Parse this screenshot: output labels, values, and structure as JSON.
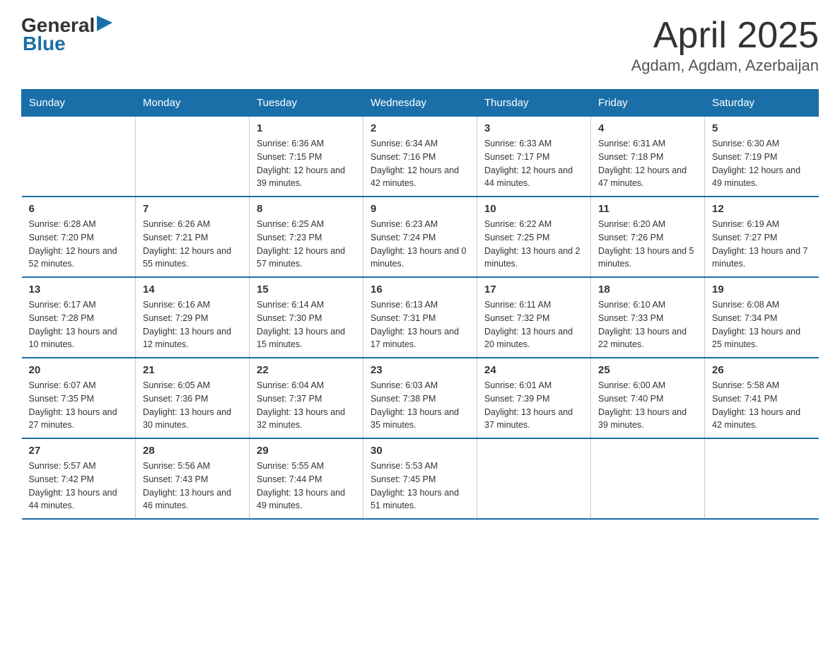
{
  "header": {
    "logo": {
      "general": "General",
      "arrow": "▶",
      "blue": "Blue"
    },
    "title": "April 2025",
    "subtitle": "Agdam, Agdam, Azerbaijan"
  },
  "calendar": {
    "weekdays": [
      "Sunday",
      "Monday",
      "Tuesday",
      "Wednesday",
      "Thursday",
      "Friday",
      "Saturday"
    ],
    "weeks": [
      [
        {
          "day": "",
          "sunrise": "",
          "sunset": "",
          "daylight": ""
        },
        {
          "day": "",
          "sunrise": "",
          "sunset": "",
          "daylight": ""
        },
        {
          "day": "1",
          "sunrise": "Sunrise: 6:36 AM",
          "sunset": "Sunset: 7:15 PM",
          "daylight": "Daylight: 12 hours and 39 minutes."
        },
        {
          "day": "2",
          "sunrise": "Sunrise: 6:34 AM",
          "sunset": "Sunset: 7:16 PM",
          "daylight": "Daylight: 12 hours and 42 minutes."
        },
        {
          "day": "3",
          "sunrise": "Sunrise: 6:33 AM",
          "sunset": "Sunset: 7:17 PM",
          "daylight": "Daylight: 12 hours and 44 minutes."
        },
        {
          "day": "4",
          "sunrise": "Sunrise: 6:31 AM",
          "sunset": "Sunset: 7:18 PM",
          "daylight": "Daylight: 12 hours and 47 minutes."
        },
        {
          "day": "5",
          "sunrise": "Sunrise: 6:30 AM",
          "sunset": "Sunset: 7:19 PM",
          "daylight": "Daylight: 12 hours and 49 minutes."
        }
      ],
      [
        {
          "day": "6",
          "sunrise": "Sunrise: 6:28 AM",
          "sunset": "Sunset: 7:20 PM",
          "daylight": "Daylight: 12 hours and 52 minutes."
        },
        {
          "day": "7",
          "sunrise": "Sunrise: 6:26 AM",
          "sunset": "Sunset: 7:21 PM",
          "daylight": "Daylight: 12 hours and 55 minutes."
        },
        {
          "day": "8",
          "sunrise": "Sunrise: 6:25 AM",
          "sunset": "Sunset: 7:23 PM",
          "daylight": "Daylight: 12 hours and 57 minutes."
        },
        {
          "day": "9",
          "sunrise": "Sunrise: 6:23 AM",
          "sunset": "Sunset: 7:24 PM",
          "daylight": "Daylight: 13 hours and 0 minutes."
        },
        {
          "day": "10",
          "sunrise": "Sunrise: 6:22 AM",
          "sunset": "Sunset: 7:25 PM",
          "daylight": "Daylight: 13 hours and 2 minutes."
        },
        {
          "day": "11",
          "sunrise": "Sunrise: 6:20 AM",
          "sunset": "Sunset: 7:26 PM",
          "daylight": "Daylight: 13 hours and 5 minutes."
        },
        {
          "day": "12",
          "sunrise": "Sunrise: 6:19 AM",
          "sunset": "Sunset: 7:27 PM",
          "daylight": "Daylight: 13 hours and 7 minutes."
        }
      ],
      [
        {
          "day": "13",
          "sunrise": "Sunrise: 6:17 AM",
          "sunset": "Sunset: 7:28 PM",
          "daylight": "Daylight: 13 hours and 10 minutes."
        },
        {
          "day": "14",
          "sunrise": "Sunrise: 6:16 AM",
          "sunset": "Sunset: 7:29 PM",
          "daylight": "Daylight: 13 hours and 12 minutes."
        },
        {
          "day": "15",
          "sunrise": "Sunrise: 6:14 AM",
          "sunset": "Sunset: 7:30 PM",
          "daylight": "Daylight: 13 hours and 15 minutes."
        },
        {
          "day": "16",
          "sunrise": "Sunrise: 6:13 AM",
          "sunset": "Sunset: 7:31 PM",
          "daylight": "Daylight: 13 hours and 17 minutes."
        },
        {
          "day": "17",
          "sunrise": "Sunrise: 6:11 AM",
          "sunset": "Sunset: 7:32 PM",
          "daylight": "Daylight: 13 hours and 20 minutes."
        },
        {
          "day": "18",
          "sunrise": "Sunrise: 6:10 AM",
          "sunset": "Sunset: 7:33 PM",
          "daylight": "Daylight: 13 hours and 22 minutes."
        },
        {
          "day": "19",
          "sunrise": "Sunrise: 6:08 AM",
          "sunset": "Sunset: 7:34 PM",
          "daylight": "Daylight: 13 hours and 25 minutes."
        }
      ],
      [
        {
          "day": "20",
          "sunrise": "Sunrise: 6:07 AM",
          "sunset": "Sunset: 7:35 PM",
          "daylight": "Daylight: 13 hours and 27 minutes."
        },
        {
          "day": "21",
          "sunrise": "Sunrise: 6:05 AM",
          "sunset": "Sunset: 7:36 PM",
          "daylight": "Daylight: 13 hours and 30 minutes."
        },
        {
          "day": "22",
          "sunrise": "Sunrise: 6:04 AM",
          "sunset": "Sunset: 7:37 PM",
          "daylight": "Daylight: 13 hours and 32 minutes."
        },
        {
          "day": "23",
          "sunrise": "Sunrise: 6:03 AM",
          "sunset": "Sunset: 7:38 PM",
          "daylight": "Daylight: 13 hours and 35 minutes."
        },
        {
          "day": "24",
          "sunrise": "Sunrise: 6:01 AM",
          "sunset": "Sunset: 7:39 PM",
          "daylight": "Daylight: 13 hours and 37 minutes."
        },
        {
          "day": "25",
          "sunrise": "Sunrise: 6:00 AM",
          "sunset": "Sunset: 7:40 PM",
          "daylight": "Daylight: 13 hours and 39 minutes."
        },
        {
          "day": "26",
          "sunrise": "Sunrise: 5:58 AM",
          "sunset": "Sunset: 7:41 PM",
          "daylight": "Daylight: 13 hours and 42 minutes."
        }
      ],
      [
        {
          "day": "27",
          "sunrise": "Sunrise: 5:57 AM",
          "sunset": "Sunset: 7:42 PM",
          "daylight": "Daylight: 13 hours and 44 minutes."
        },
        {
          "day": "28",
          "sunrise": "Sunrise: 5:56 AM",
          "sunset": "Sunset: 7:43 PM",
          "daylight": "Daylight: 13 hours and 46 minutes."
        },
        {
          "day": "29",
          "sunrise": "Sunrise: 5:55 AM",
          "sunset": "Sunset: 7:44 PM",
          "daylight": "Daylight: 13 hours and 49 minutes."
        },
        {
          "day": "30",
          "sunrise": "Sunrise: 5:53 AM",
          "sunset": "Sunset: 7:45 PM",
          "daylight": "Daylight: 13 hours and 51 minutes."
        },
        {
          "day": "",
          "sunrise": "",
          "sunset": "",
          "daylight": ""
        },
        {
          "day": "",
          "sunrise": "",
          "sunset": "",
          "daylight": ""
        },
        {
          "day": "",
          "sunrise": "",
          "sunset": "",
          "daylight": ""
        }
      ]
    ]
  }
}
